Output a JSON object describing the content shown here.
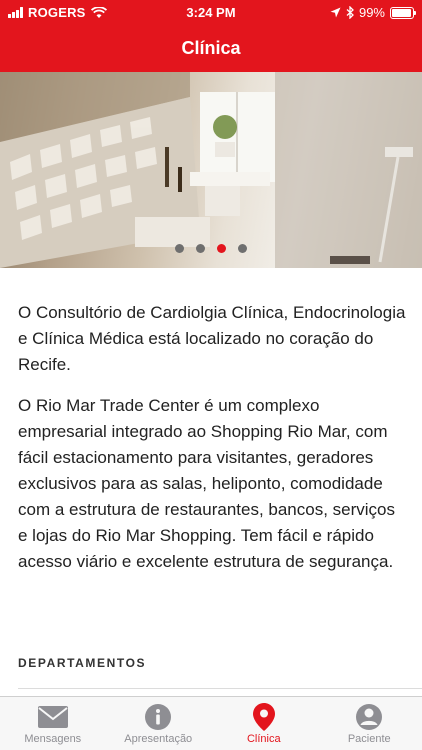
{
  "status_bar": {
    "carrier": "ROGERS",
    "time": "3:24 PM",
    "battery": "99%"
  },
  "nav": {
    "title": "Clínica"
  },
  "carousel": {
    "page_count": 4,
    "active_index": 2
  },
  "content": {
    "paragraphs": [
      "O Consultório de Cardiolgia Clínica, Endocrinologia e Clínica Médica está localizado no coração do Recife.",
      "O Rio Mar Trade Center é um complexo empresarial integrado ao Shopping Rio Mar, com fácil estacionamento para visitantes, geradores exclusivos para as salas, heliponto, comodidade com a estrutura de restaurantes, bancos, serviços e lojas do Rio Mar Shopping. Tem fácil e rápido acesso viário e excelente estrutura de segurança."
    ]
  },
  "section": {
    "title": "DEPARTAMENTOS"
  },
  "tabs": [
    {
      "label": "Mensagens",
      "icon": "envelope-icon"
    },
    {
      "label": "Apresentação",
      "icon": "info-icon"
    },
    {
      "label": "Clínica",
      "icon": "map-pin-icon",
      "active": true
    },
    {
      "label": "Paciente",
      "icon": "person-icon"
    }
  ],
  "colors": {
    "brand": "#e3151d",
    "inactive": "#8e8e93"
  }
}
